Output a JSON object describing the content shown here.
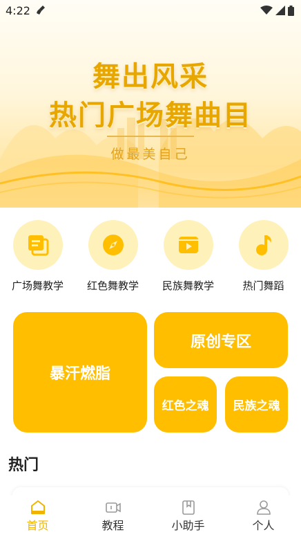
{
  "status": {
    "time": "4:22"
  },
  "hero": {
    "title_line1": "舞出风采",
    "title_line2": "热门广场舞曲目",
    "subtitle": "做最美自己"
  },
  "categories": [
    {
      "label": "广场舞教学",
      "icon": "layers-icon"
    },
    {
      "label": "红色舞教学",
      "icon": "compass-icon"
    },
    {
      "label": "民族舞教学",
      "icon": "video-icon"
    },
    {
      "label": "热门舞蹈",
      "icon": "music-note-icon"
    }
  ],
  "tiles": {
    "big": "暴汗燃脂",
    "wide": "原创专区",
    "small1": "红色之魂",
    "small2": "民族之魂"
  },
  "section": {
    "hot_title": "热门"
  },
  "tabbar": [
    {
      "label": "首页",
      "active": true
    },
    {
      "label": "教程",
      "active": false
    },
    {
      "label": "小助手",
      "active": false
    },
    {
      "label": "个人",
      "active": false
    }
  ],
  "colors": {
    "accent": "#ffbe00",
    "accent_light": "#fff1ba",
    "tab_active": "#f0b400"
  }
}
